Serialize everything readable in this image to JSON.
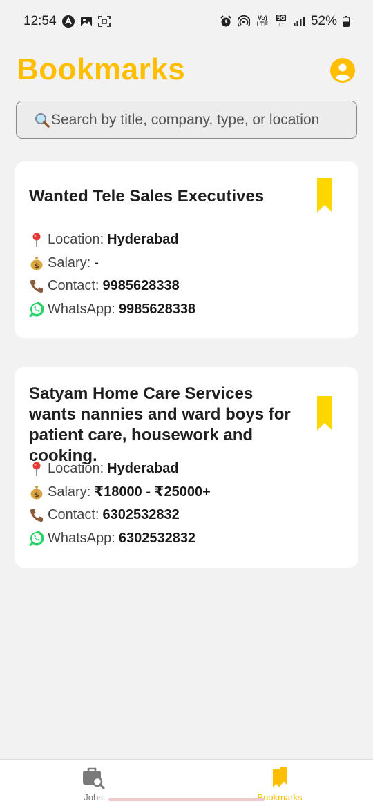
{
  "status_bar": {
    "time": "12:54",
    "network_top": "Vo)",
    "network_bottom": "LTE",
    "network_5g": "5G",
    "battery": "52%"
  },
  "header": {
    "title": "Bookmarks",
    "profile_icon": "user-circle-icon"
  },
  "search": {
    "placeholder": "Search by title, company, type, or location",
    "value": ""
  },
  "colors": {
    "accent": "#ffbf00",
    "bookmark": "#ffd700",
    "whatsapp": "#25d366",
    "background": "#f2f2f2"
  },
  "bookmarks": [
    {
      "title": "Wanted Tele Sales Executives",
      "location_label": "Location:",
      "location": "Hyderabad",
      "salary_label": "Salary:",
      "salary": "-",
      "contact_label": "Contact:",
      "contact": "9985628338",
      "whatsapp_label": "WhatsApp:",
      "whatsapp": "9985628338",
      "bookmarked": true
    },
    {
      "title": "Satyam Home Care Services wants nannies and ward boys for patient care, housework and cooking.",
      "location_label": "Location:",
      "location": "Hyderabad",
      "salary_label": "Salary:",
      "salary": "₹18000 - ₹25000+",
      "contact_label": "Contact:",
      "contact": "6302532832",
      "whatsapp_label": "WhatsApp:",
      "whatsapp": "6302532832",
      "bookmarked": true
    }
  ],
  "bottom_nav": {
    "items": [
      {
        "label": "Jobs",
        "icon": "briefcase-search-icon",
        "active": false
      },
      {
        "label": "Bookmarks",
        "icon": "bookmarks-icon",
        "active": true
      }
    ]
  }
}
